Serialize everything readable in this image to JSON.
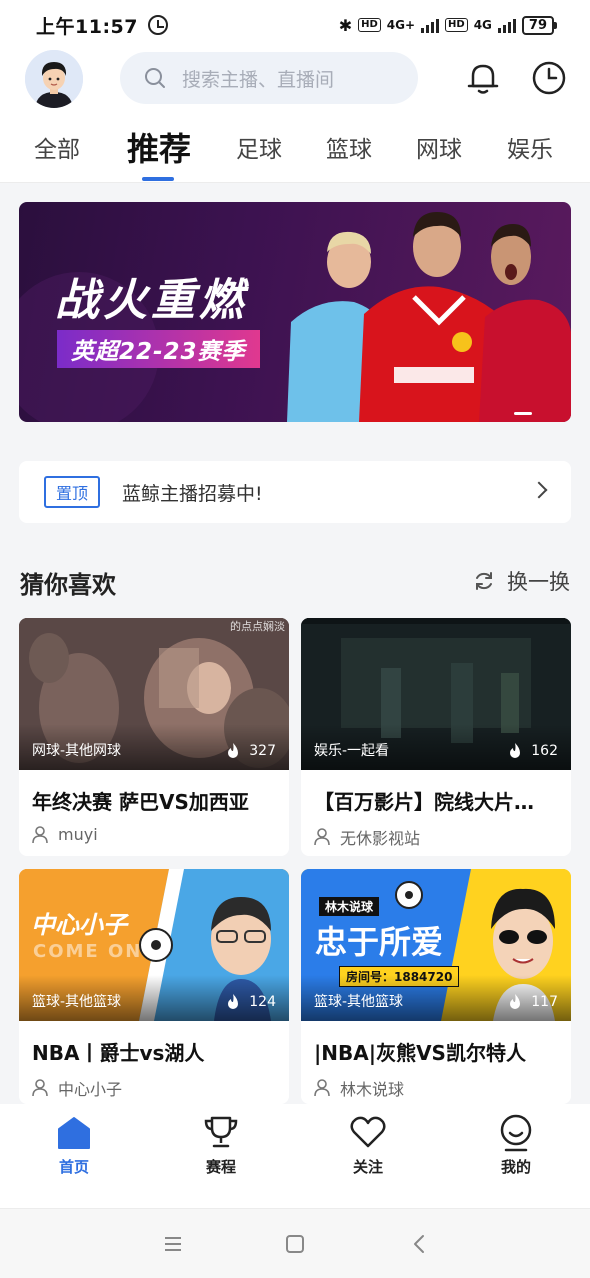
{
  "status_bar": {
    "time": "上午11:57",
    "network_label_1": "4G+",
    "network_label_2": "4G",
    "hd": "HD",
    "battery": "79"
  },
  "header": {
    "search_placeholder": "搜索主播、直播间"
  },
  "tabs": [
    "全部",
    "推荐",
    "足球",
    "篮球",
    "网球",
    "娱乐"
  ],
  "active_tab": "推荐",
  "banner": {
    "title": "战火重燃",
    "subtitle": "英超22-23赛季"
  },
  "notice": {
    "tag": "置顶",
    "text": "蓝鲸主播招募中!"
  },
  "section": {
    "title": "猜你喜欢",
    "refresh_label": "换一换"
  },
  "cards": [
    {
      "category": "网球-其他网球",
      "heat": "327",
      "title": "年终决赛 萨巴VS加西亚",
      "host": "muyi",
      "watermark": "的点点娴淡"
    },
    {
      "category": "娱乐-一起看",
      "heat": "162",
      "title": "【百万影片】院线大片…",
      "host": "无休影视站"
    },
    {
      "category": "篮球-其他篮球",
      "heat": "124",
      "title": "NBA丨爵士vs湖人",
      "host": "中心小子",
      "cover_text": "中心小子",
      "cover_sub": "COME ON"
    },
    {
      "category": "篮球-其他篮球",
      "heat": "117",
      "title": "|NBA|灰熊VS凯尔特人",
      "host": "林木说球",
      "cover_tag": "林木说球",
      "cover_text": "忠于所爱",
      "cover_room": "房间号：1884720"
    }
  ],
  "bottom_nav": [
    {
      "label": "首页",
      "icon": "home-icon"
    },
    {
      "label": "赛程",
      "icon": "trophy-icon"
    },
    {
      "label": "关注",
      "icon": "heart-icon"
    },
    {
      "label": "我的",
      "icon": "profile-icon"
    }
  ],
  "colors": {
    "accent": "#2f6fe0",
    "background": "#f4f5f7"
  }
}
